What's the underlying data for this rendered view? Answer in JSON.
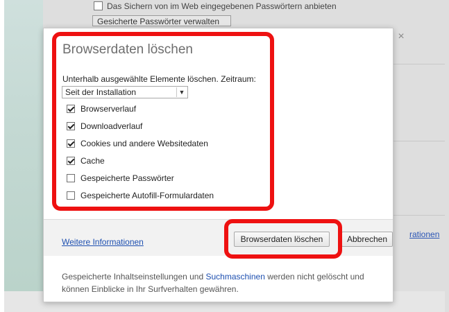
{
  "background": {
    "partial_checkbox_text": "Das Sichern von im Web eingegebenen Passwörtern anbieten",
    "partial_button_text": "Gesicherte Passwörter verwalten",
    "partial_link_text": "rationen"
  },
  "dialog": {
    "title": "Browserdaten löschen",
    "close_glyph": "×",
    "range_label": "Unterhalb ausgewählte Elemente löschen. Zeitraum:",
    "range_value": "Seit der Installation",
    "options": [
      {
        "label": "Browserverlauf",
        "checked": true
      },
      {
        "label": "Downloadverlauf",
        "checked": true
      },
      {
        "label": "Cookies und andere Websitedaten",
        "checked": true
      },
      {
        "label": "Cache",
        "checked": true
      },
      {
        "label": "Gespeicherte Passwörter",
        "checked": false
      },
      {
        "label": "Gespeicherte Autofill-Formulardaten",
        "checked": false
      }
    ],
    "more_info_link": "Weitere Informationen",
    "clear_button": "Browserdaten löschen",
    "cancel_button": "Abbrechen",
    "note_before": "Gespeicherte Inhaltseinstellungen und ",
    "note_link": "Suchmaschinen",
    "note_after": " werden nicht gelöscht und können Einblicke in Ihr Surfverhalten gewähren."
  },
  "colors": {
    "highlight": "#ee1111",
    "link": "#1d4fb0"
  },
  "icons": {
    "close": "close-icon",
    "dropdown": "chevron-down-icon",
    "checkbox": "checkmark-icon"
  }
}
